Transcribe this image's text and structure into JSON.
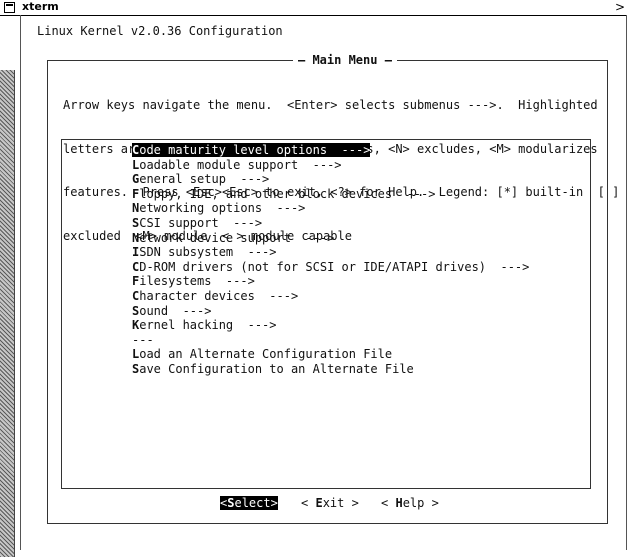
{
  "window": {
    "title": "xterm",
    "close_glyph": ">"
  },
  "terminal": {
    "screen_title": "Linux Kernel v2.0.36 Configuration"
  },
  "dialog": {
    "title": "Main Menu",
    "help_lines": [
      "Arrow keys navigate the menu.  <Enter> selects submenus --->.  Highlighted",
      "letters are hotkeys.  Pressing <Y> includes, <N> excludes, <M> modularizes",
      "features.  Press <Esc><Esc> to exit, <?> for Help.  Legend: [*] built-in  [ ]",
      "excluded  <M> module  < > module capable"
    ]
  },
  "menu": {
    "items": [
      {
        "hotkey": "C",
        "rest": "ode maturity level options  --->"
      },
      {
        "hotkey": "L",
        "rest": "oadable module support  --->"
      },
      {
        "hotkey": "G",
        "rest": "eneral setup  --->"
      },
      {
        "hotkey": "F",
        "rest": "loppy, IDE, and other block devices  --->"
      },
      {
        "hotkey": "N",
        "rest": "etworking options  --->"
      },
      {
        "hotkey": "S",
        "rest": "CSI support  --->"
      },
      {
        "hotkey": "N",
        "rest": "etwork device support  --->"
      },
      {
        "hotkey": "I",
        "rest": "SDN subsystem  --->"
      },
      {
        "hotkey": "C",
        "rest": "D-ROM drivers (not for SCSI or IDE/ATAPI drives)  --->"
      },
      {
        "hotkey": "F",
        "rest": "ilesystems  --->"
      },
      {
        "hotkey": "C",
        "rest": "haracter devices  --->"
      },
      {
        "hotkey": "S",
        "rest": "ound  --->"
      },
      {
        "hotkey": "K",
        "rest": "ernel hacking  --->"
      },
      {
        "hotkey": "",
        "rest": "---"
      },
      {
        "hotkey": "L",
        "rest": "oad an Alternate Configuration File"
      },
      {
        "hotkey": "S",
        "rest": "ave Configuration to an Alternate File"
      }
    ]
  },
  "buttons": {
    "select": {
      "left": "<",
      "hotkey": "S",
      "rest": "elect>"
    },
    "exit": {
      "left": "< ",
      "hotkey": "E",
      "rest": "xit >"
    },
    "help": {
      "left": "< ",
      "hotkey": "H",
      "rest": "elp >"
    }
  },
  "colors": {
    "background": "#ffffff",
    "text": "#111111",
    "highlight_bg": "#000000",
    "highlight_fg": "#ffffff"
  }
}
